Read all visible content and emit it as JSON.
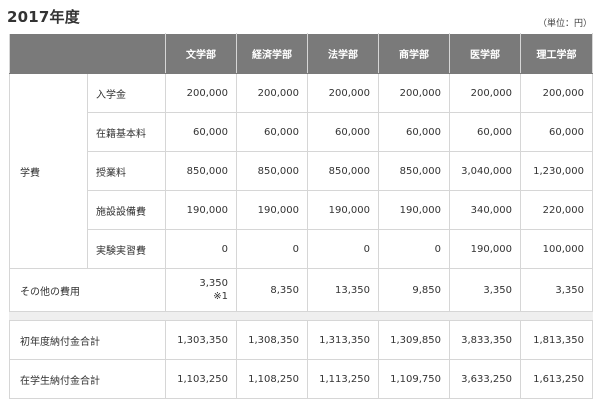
{
  "title": "2017年度",
  "unit": "（単位：円）",
  "columns": [
    "文学部",
    "経済学部",
    "法学部",
    "商学部",
    "医学部",
    "理工学部"
  ],
  "tuition": {
    "group_label": "学費",
    "rows": [
      {
        "label": "入学金",
        "values": [
          "200,000",
          "200,000",
          "200,000",
          "200,000",
          "200,000",
          "200,000"
        ]
      },
      {
        "label": "在籍基本料",
        "values": [
          "60,000",
          "60,000",
          "60,000",
          "60,000",
          "60,000",
          "60,000"
        ]
      },
      {
        "label": "授業料",
        "values": [
          "850,000",
          "850,000",
          "850,000",
          "850,000",
          "3,040,000",
          "1,230,000"
        ]
      },
      {
        "label": "施設設備費",
        "values": [
          "190,000",
          "190,000",
          "190,000",
          "190,000",
          "340,000",
          "220,000"
        ]
      },
      {
        "label": "実験実習費",
        "values": [
          "0",
          "0",
          "0",
          "0",
          "190,000",
          "100,000"
        ]
      }
    ]
  },
  "other": {
    "label": "その他の費用",
    "values": [
      "3,350",
      "8,350",
      "13,350",
      "9,850",
      "3,350",
      "3,350"
    ],
    "note": "※1"
  },
  "totals": [
    {
      "label": "初年度納付金合計",
      "values": [
        "1,303,350",
        "1,308,350",
        "1,313,350",
        "1,309,850",
        "3,833,350",
        "1,813,350"
      ]
    },
    {
      "label": "在学生納付金合計",
      "values": [
        "1,103,250",
        "1,108,250",
        "1,113,250",
        "1,109,750",
        "3,633,250",
        "1,613,250"
      ]
    }
  ]
}
